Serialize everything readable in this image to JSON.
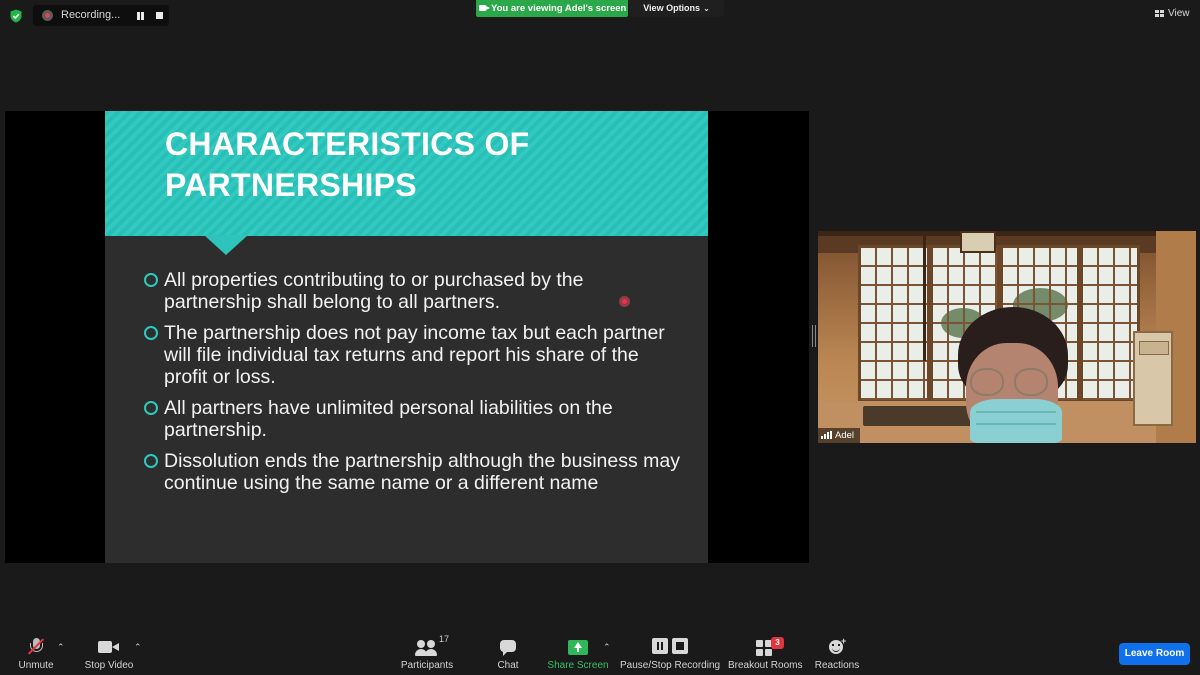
{
  "top_bar": {
    "recording_label": "Recording...",
    "viewing_banner": "You are viewing Adel's screen",
    "view_options_label": "View Options",
    "view_label": "View"
  },
  "slide": {
    "title_line1": "CHARACTERISTICS OF",
    "title_line2": "PARTNERSHIPS",
    "bullets": [
      "All properties contributing to or purchased by the partnership shall belong to all partners.",
      "The partnership does not pay income tax but each partner will file individual tax returns and report his share of the profit or loss.",
      "All partners have unlimited personal liabilities on the partnership.",
      "Dissolution ends the partnership although the business may continue using the same name or a different name"
    ],
    "colors": {
      "accent": "#2ec4bb",
      "background": "#2d2d2e"
    }
  },
  "participant_video": {
    "name": "Adel"
  },
  "toolbar": {
    "unmute_label": "Unmute",
    "stop_video_label": "Stop Video",
    "participants_label": "Participants",
    "participants_count": "17",
    "chat_label": "Chat",
    "share_screen_label": "Share Screen",
    "recording_label": "Pause/Stop Recording",
    "breakout_label": "Breakout Rooms",
    "breakout_badge": "3",
    "reactions_label": "Reactions",
    "leave_label": "Leave Room"
  },
  "icons": {
    "shield": "shield-check-icon",
    "mic": "mic-muted-icon",
    "video": "video-camera-icon",
    "participants": "people-icon",
    "chat": "chat-bubble-icon",
    "share": "share-screen-icon",
    "record": "pause-stop-icon",
    "breakout": "breakout-grid-icon",
    "reactions": "emoji-plus-icon"
  },
  "colors": {
    "share_green": "#2fb75a",
    "banner_green": "#2ba84a",
    "leave_blue": "#0e71eb",
    "alert_red": "#e0353f"
  }
}
